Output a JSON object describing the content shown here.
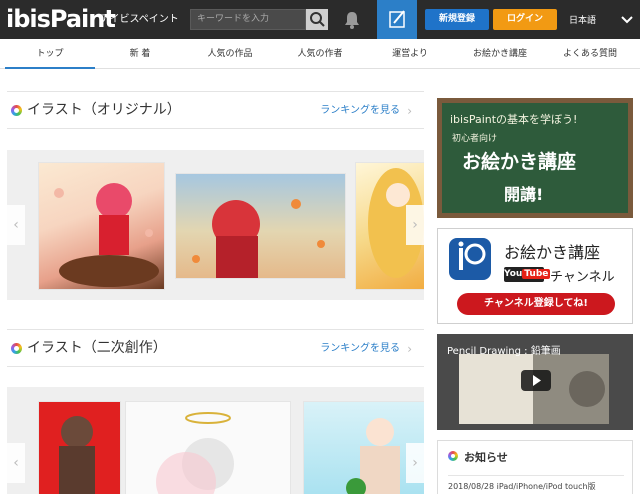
{
  "header": {
    "logo_text": "ibisPaint",
    "logo_sub": "アイビスペイント",
    "search_placeholder": "キーワードを入力",
    "register_label": "新規登録",
    "login_label": "ログイン",
    "language": "日本語"
  },
  "nav": {
    "items": [
      {
        "label": "トップ"
      },
      {
        "label": "新 着"
      },
      {
        "label": "人気の作品"
      },
      {
        "label": "人気の作者"
      },
      {
        "label": "運営より"
      },
      {
        "label": "お絵かき講座"
      },
      {
        "label": "よくある質問"
      }
    ]
  },
  "sections": [
    {
      "title": "イラスト（オリジナル）",
      "link": "ランキングを見る"
    },
    {
      "title": "イラスト（二次創作）",
      "link": "ランキングを見る"
    }
  ],
  "sidebar": {
    "board": {
      "line1": "ibisPaintの基本を学ぼう!",
      "line2": "初心者向け",
      "line3": "お絵かき講座",
      "line4": "開講!"
    },
    "youtube": {
      "title": "お絵かき講座",
      "logo_you": "You",
      "logo_tube": "Tube",
      "channel": "チャンネル",
      "subscribe": "チャンネル登録してね!"
    },
    "video": {
      "title": "Pencil Drawing : 鉛筆画"
    },
    "notice": {
      "title": "お知らせ",
      "item": "2018/08/28 iPad/iPhone/iPod touch版"
    }
  },
  "colors": {
    "header_bg": "#2b2b2b",
    "accent_blue": "#2c7fc8",
    "login_orange": "#f29a13",
    "register_blue": "#1f73c9",
    "youtube_red": "#cc181e"
  }
}
